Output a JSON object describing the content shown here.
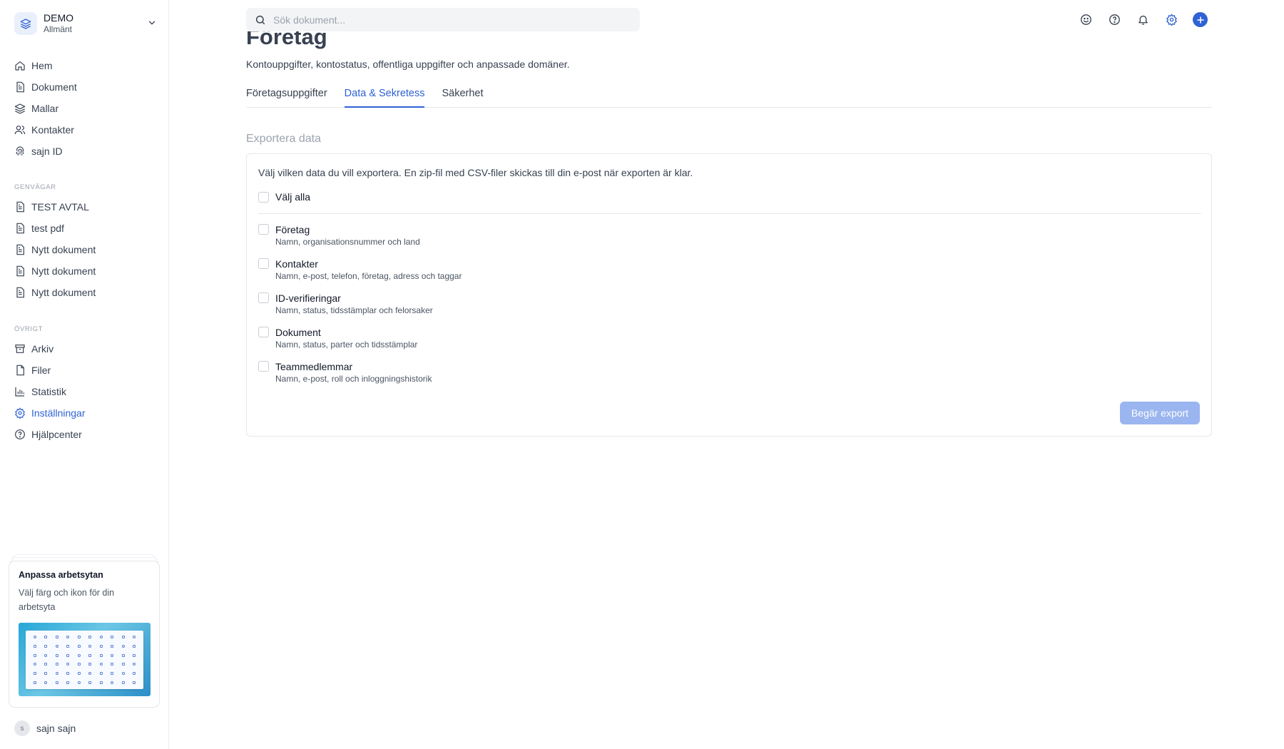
{
  "workspace": {
    "name": "DEMO",
    "subtitle": "Allmänt"
  },
  "nav": {
    "main": [
      {
        "label": "Hem",
        "icon": "home-icon"
      },
      {
        "label": "Dokument",
        "icon": "document-icon"
      },
      {
        "label": "Mallar",
        "icon": "layers-icon"
      },
      {
        "label": "Kontakter",
        "icon": "users-icon"
      },
      {
        "label": "sajn ID",
        "icon": "fingerprint-icon"
      }
    ],
    "shortcuts_heading": "GENVÄGAR",
    "shortcuts": [
      {
        "label": "TEST AVTAL"
      },
      {
        "label": "test pdf"
      },
      {
        "label": "Nytt dokument"
      },
      {
        "label": "Nytt dokument"
      },
      {
        "label": "Nytt dokument"
      }
    ],
    "other_heading": "ÖVRIGT",
    "other": [
      {
        "label": "Arkiv",
        "icon": "archive-icon"
      },
      {
        "label": "Filer",
        "icon": "file-icon"
      },
      {
        "label": "Statistik",
        "icon": "chart-icon"
      },
      {
        "label": "Inställningar",
        "icon": "gear-icon",
        "active": true
      },
      {
        "label": "Hjälpcenter",
        "icon": "help-icon"
      }
    ]
  },
  "promo": {
    "title": "Anpassa arbetsytan",
    "description": "Välj färg och ikon för din arbetsyta"
  },
  "user": {
    "initial": "s",
    "name": "sajn sajn"
  },
  "search": {
    "placeholder": "Sök dokument..."
  },
  "page": {
    "title": "Företag",
    "subtitle": "Kontouppgifter, kontostatus, offentliga uppgifter och anpassade domäner.",
    "tabs": [
      {
        "label": "Företagsuppgifter"
      },
      {
        "label": "Data & Sekretess",
        "active": true
      },
      {
        "label": "Säkerhet"
      }
    ]
  },
  "export": {
    "section_title": "Exportera data",
    "description": "Välj vilken data du vill exportera. En zip-fil med CSV-filer skickas till din e-post när exporten är klar.",
    "select_all": "Välj alla",
    "options": [
      {
        "label": "Företag",
        "desc": "Namn, organisationsnummer och land"
      },
      {
        "label": "Kontakter",
        "desc": "Namn, e-post, telefon, företag, adress och taggar"
      },
      {
        "label": "ID-verifieringar",
        "desc": "Namn, status, tidsstämplar och felorsaker"
      },
      {
        "label": "Dokument",
        "desc": "Namn, status, parter och tidsstämplar"
      },
      {
        "label": "Teammedlemmar",
        "desc": "Namn, e-post, roll och inloggningshistorik"
      }
    ],
    "button": "Begär export"
  },
  "colors": {
    "accent": "#2f62d4",
    "button_disabled": "#9ab5ef"
  }
}
